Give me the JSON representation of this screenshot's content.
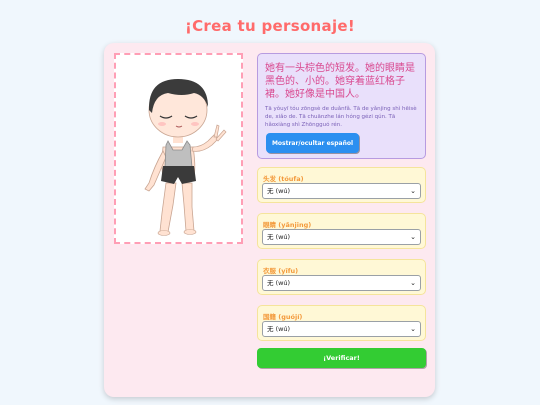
{
  "page": {
    "title": "¡Crea tu personaje!"
  },
  "description": {
    "chinese": "她有一头棕色的短发。她的眼睛是黑色的、小的。她穿着蓝红格子裙。她好像是中国人。",
    "pinyin": "Tā yǒuyī tóu zōngsè de duǎnfǎ. Tā de yǎnjing shì hēisè de, xiǎo de. Tā chuānzhe lán hóng gézi qún. Tā hǎoxiàng shì Zhōngguó rén.",
    "toggle_label": "Mostrar/ocultar español"
  },
  "fields": [
    {
      "label": "头发 (tóufa)",
      "value": "无 (wú)"
    },
    {
      "label": "眼睛 (yǎnjing)",
      "value": "无 (wú)"
    },
    {
      "label": "衣服 (yīfu)",
      "value": "无 (wú)"
    },
    {
      "label": "国籍 (guójí)",
      "value": "无 (wú)"
    }
  ],
  "verify_label": "¡Verificar!",
  "colors": {
    "title": "#ff6b6b",
    "card": "#fde9f0",
    "portrait_border": "#ff9eb5",
    "description_bg": "#e9e0fb",
    "chinese_text": "#d9488f",
    "toggle_button": "#2b8ff0",
    "field_bg": "#fff8d6",
    "field_label": "#f39a3c",
    "verify_button": "#33cc33"
  },
  "icons": {
    "character": "chibi-character-illustration",
    "dropdown": "chevron-down-icon"
  }
}
